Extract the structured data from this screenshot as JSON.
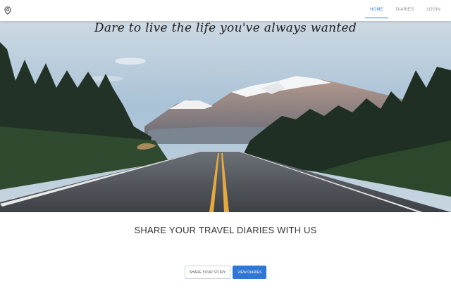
{
  "nav": {
    "logo_icon": "location-pin-icon",
    "links": [
      {
        "label": "HOME",
        "active": true
      },
      {
        "label": "DIARIES",
        "active": false
      },
      {
        "label": "LOGIN",
        "active": false
      }
    ],
    "accent": "#3b7ddd"
  },
  "hero": {
    "tagline": "Dare to live the life you've always wanted",
    "image": "mountain-road-forest-photo"
  },
  "main": {
    "heading": "SHARE YOUR TRAVEL DIARIES WITH US",
    "buttons": {
      "share_label": "SHARE YOUR STORY",
      "view_label": "VIEW DIARIES"
    },
    "primary_color": "#2f77d6"
  }
}
